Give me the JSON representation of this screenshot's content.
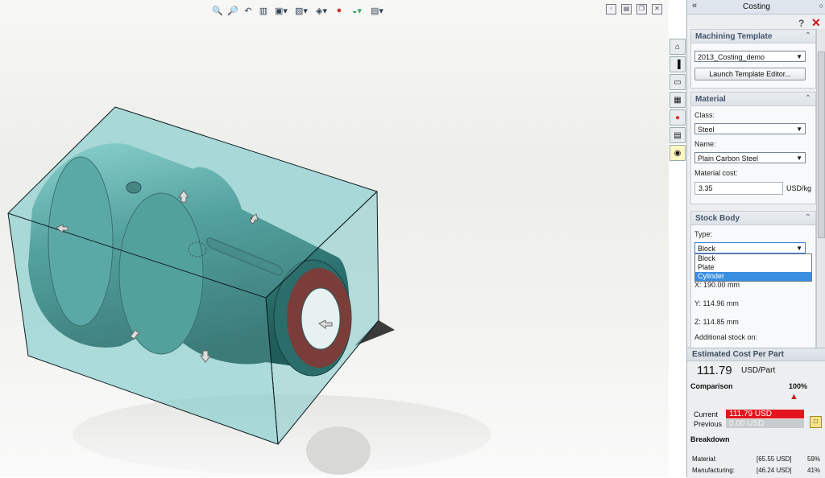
{
  "toolbar": {
    "icons": [
      "zoom-to-fit-icon",
      "zoom-area-icon",
      "previous-view-icon",
      "section-view-icon",
      "view-orientation-icon",
      "display-style-icon",
      "hide-show-icon",
      "edit-appearance-icon",
      "apply-scene-icon",
      "view-settings-icon"
    ]
  },
  "window_controls": [
    "restore-icon",
    "tile-icon",
    "copy-icon",
    "close-icon"
  ],
  "taskpane_tabs": [
    "home-icon",
    "chart-icon",
    "folder-icon",
    "view-palette-icon",
    "appearance-icon",
    "custom-props-icon",
    "costing-icon"
  ],
  "panel": {
    "title": "Costing",
    "collapse_glyph": "«",
    "machining": {
      "title": "Machining Template",
      "template_value": "2013_Costing_demo",
      "launch_label": "Launch Template Editor..."
    },
    "material": {
      "title": "Material",
      "class_label": "Class:",
      "class_value": "Steel",
      "name_label": "Name:",
      "name_value": "Plain Carbon Steel",
      "cost_label": "Material cost:",
      "cost_value": "3.35",
      "cost_unit": "USD/kg"
    },
    "stock": {
      "title": "Stock Body",
      "type_label": "Type:",
      "type_value": "Block",
      "options": [
        "Block",
        "Plate",
        "Cylinder"
      ],
      "x_label": "X: 190.00 mm",
      "y_label": "Y: 114.96 mm",
      "z_label": "Z: 114.85 mm",
      "additional_label": "Additional stock on:"
    }
  },
  "cost": {
    "title": "Estimated Cost Per Part",
    "value": "111.79",
    "unit": "USD/Part",
    "comparison_title": "Comparison",
    "pct": "100%",
    "current_label": "Current",
    "current_value": "111.79 USD",
    "previous_label": "Previous",
    "previous_value": "0.00 USD",
    "breakdown_title": "Breakdown",
    "breakdown": [
      {
        "label": "Material:",
        "value": "[65.55 USD]",
        "pct": "59%"
      },
      {
        "label": "Manufacturing:",
        "value": "[46.24 USD]",
        "pct": "41%"
      }
    ]
  },
  "colors": {
    "accent_red": "#e3141b",
    "model_teal": "#4a9a9a",
    "stock_box": "#7fc9c8"
  }
}
